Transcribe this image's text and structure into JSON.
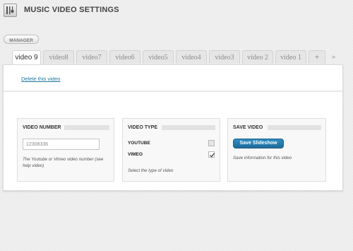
{
  "header": {
    "title": "MUSIC VIDEO SETTINGS",
    "logo_icon": "guitar-icon"
  },
  "manager_button": {
    "label": "MANAGER"
  },
  "tabs": [
    {
      "label": "video 9",
      "active": true
    },
    {
      "label": "video8",
      "active": false
    },
    {
      "label": "video7",
      "active": false
    },
    {
      "label": "video6",
      "active": false
    },
    {
      "label": "video5",
      "active": false
    },
    {
      "label": "video4",
      "active": false
    },
    {
      "label": "video3",
      "active": false
    },
    {
      "label": "video 2",
      "active": false
    },
    {
      "label": "video 1",
      "active": false
    }
  ],
  "add_tab": {
    "label": "+"
  },
  "tab_scroll": {
    "label": "»"
  },
  "delete_link": {
    "label": "Delete this video"
  },
  "video_number": {
    "heading": "VIDEO NUMBER",
    "value": "12308336",
    "help": "The Youtube or Vimeo video number (see help video)"
  },
  "video_type": {
    "heading": "VIDEO TYPE",
    "options": [
      {
        "label": "YOUTUBE",
        "checked": false
      },
      {
        "label": "VIMEO",
        "checked": true
      }
    ],
    "help": "Select the type of video"
  },
  "save_video": {
    "heading": "SAVE VIDEO",
    "button_label": "Save Slideshow",
    "help": "Save information for this video"
  },
  "colors": {
    "accent": "#21759b",
    "button": "#2681b5",
    "panel": "#ffffff",
    "page": "#ececec"
  }
}
